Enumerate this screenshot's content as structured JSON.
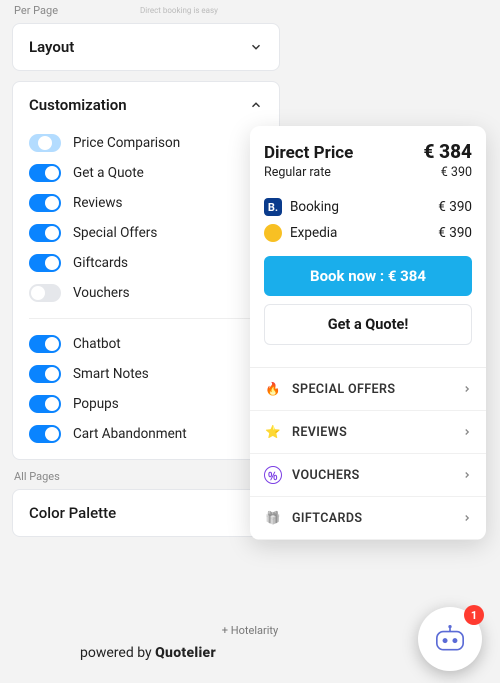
{
  "perPageLabel": "Per Page",
  "allPagesLabel": "All Pages",
  "smallCaption": "Direct booking is easy",
  "layoutPanel": {
    "title": "Layout"
  },
  "customization": {
    "title": "Customization",
    "groupA": [
      {
        "label": "Price Comparison",
        "state": "partial"
      },
      {
        "label": "Get a Quote",
        "state": "on"
      },
      {
        "label": "Reviews",
        "state": "on"
      },
      {
        "label": "Special Offers",
        "state": "on"
      },
      {
        "label": "Giftcards",
        "state": "on"
      },
      {
        "label": "Vouchers",
        "state": "off"
      }
    ],
    "groupB": [
      {
        "label": "Chatbot",
        "state": "on"
      },
      {
        "label": "Smart Notes",
        "state": "on"
      },
      {
        "label": "Popups",
        "state": "on"
      },
      {
        "label": "Cart Abandonment",
        "state": "on"
      }
    ]
  },
  "colorPanel": {
    "title": "Color Palette"
  },
  "preview": {
    "directTitle": "Direct Price",
    "directPrice": "€ 384",
    "regularLabel": "Regular rate",
    "regularPrice": "€ 390",
    "otas": [
      {
        "name": "Booking",
        "price": "€ 390",
        "iconClass": "ota-booking",
        "iconText": "B."
      },
      {
        "name": "Expedia",
        "price": "€ 390",
        "iconClass": "ota-expedia",
        "iconText": ""
      }
    ],
    "bookNow": "Book now : € 384",
    "getQuote": "Get a Quote!",
    "features": [
      {
        "label": "SPECIAL OFFERS",
        "icon": "🔥"
      },
      {
        "label": "REVIEWS",
        "icon": "⭐"
      },
      {
        "label": "VOUCHERS",
        "icon": "％",
        "iconColor": "#7b3fe4"
      },
      {
        "label": "GIFTCARDS",
        "icon": "🎁",
        "muted": true
      }
    ]
  },
  "footerBrand": "+ Hotelarity",
  "powered": {
    "pre": "powered by ",
    "brand": "Quotelier"
  },
  "chatbot": {
    "badge": "1"
  }
}
